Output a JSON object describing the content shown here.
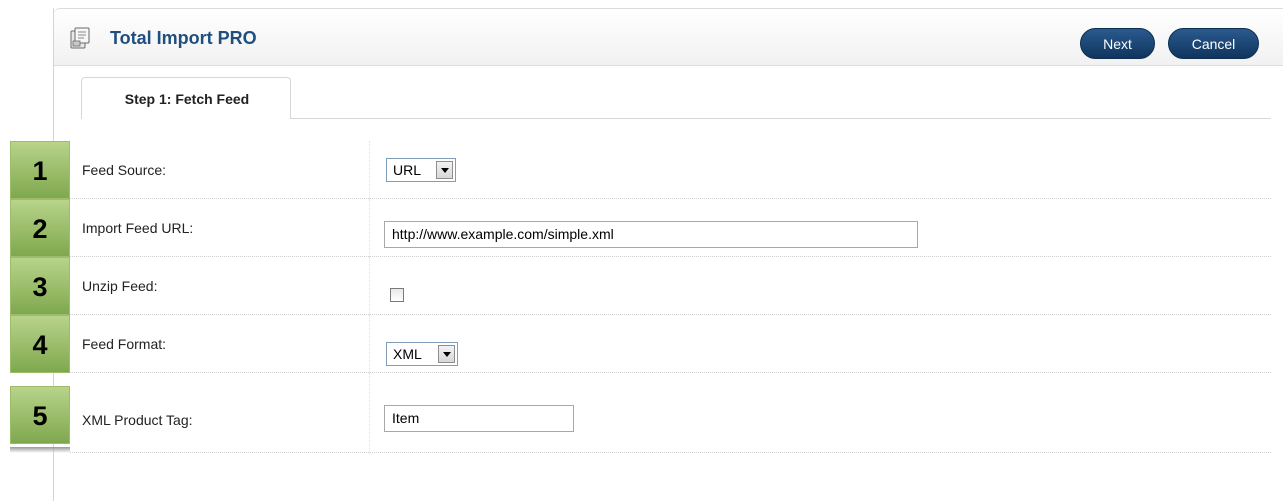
{
  "header": {
    "title": "Total Import PRO",
    "icon": "import-document-icon",
    "buttons": {
      "next_label": "Next",
      "cancel_label": "Cancel"
    }
  },
  "tabs": [
    {
      "label": "Step 1: Fetch Feed",
      "active": true
    }
  ],
  "form": {
    "rows": [
      {
        "number": "1",
        "label": "Feed Source:",
        "control": "select",
        "value": "URL"
      },
      {
        "number": "2",
        "label": "Import Feed URL:",
        "control": "text",
        "value": "http://www.example.com/simple.xml"
      },
      {
        "number": "3",
        "label": "Unzip Feed:",
        "control": "checkbox",
        "checked": false
      },
      {
        "number": "4",
        "label": "Feed Format:",
        "control": "select",
        "value": "XML"
      },
      {
        "number": "5",
        "label": "XML Product Tag:",
        "control": "text",
        "value": "Item"
      }
    ]
  },
  "colors": {
    "title": "#1f4f7e",
    "button": "#1b4674",
    "step_badge": "#9ec06c"
  }
}
